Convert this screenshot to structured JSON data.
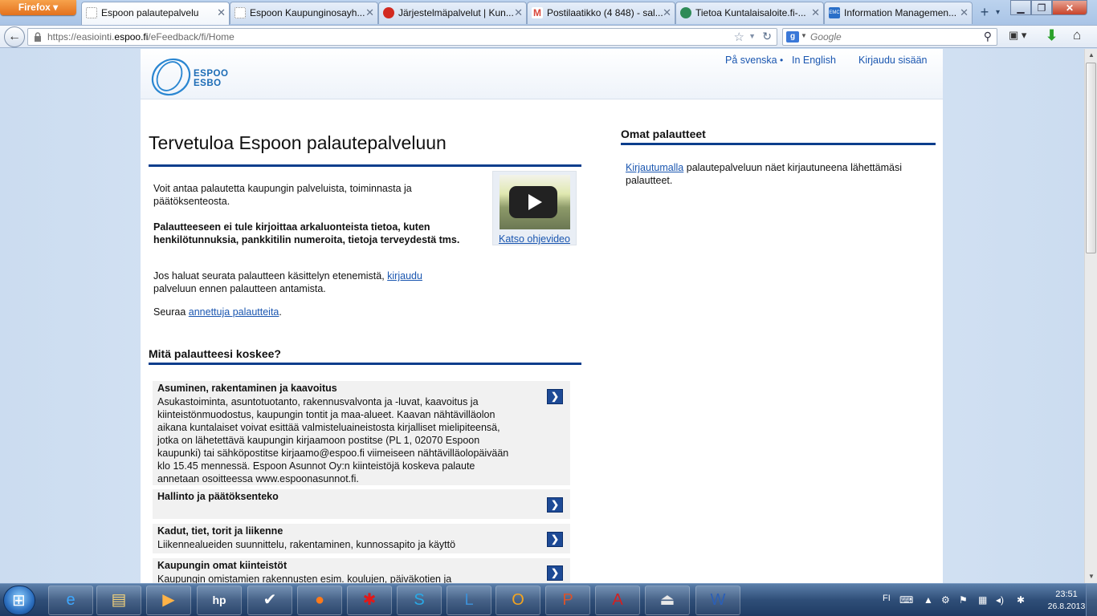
{
  "browser": {
    "menu_button": "Firefox",
    "tabs": [
      {
        "title": "Espoon palautepalvelu",
        "favicon_color": "#ffffff",
        "active": true
      },
      {
        "title": "Espoon Kaupunginosayh...",
        "favicon_color": "#ffffff",
        "active": false
      },
      {
        "title": "Järjestelmäpalvelut | Kun...",
        "favicon_color": "#d22a20",
        "active": false
      },
      {
        "title": "Postilaatikko (4 848) - sal...",
        "favicon_color": "#d9453a",
        "active": false
      },
      {
        "title": "Tietoa Kuntalaisaloite.fi-...",
        "favicon_color": "#2e8b57",
        "active": false
      },
      {
        "title": "Information Managemen...",
        "favicon_color": "#2a6fc8",
        "active": false
      }
    ],
    "url_prefix": "https://easiointi.",
    "url_domain": "espoo.fi",
    "url_path": "/eFeedback/fi/Home",
    "search_placeholder": "Google",
    "search_engine_icon_letter": "g"
  },
  "header": {
    "logo_line1": "ESPOO",
    "logo_line2": "ESBO",
    "link_swedish": "På svenska",
    "link_separator": "•",
    "link_english": "In English",
    "link_login": "Kirjaudu sisään"
  },
  "main": {
    "heading": "Tervetuloa Espoon palautepalveluun",
    "intro_text": "Voit antaa palautetta kaupungin palveluista, toiminnasta ja päätöksenteosta.",
    "warning_text": "Palautteeseen ei tule kirjoittaa arkaluonteista tietoa, kuten henkilötunnuksia, pankkitilin numeroita, tietoja terveydestä tms.",
    "follow_text_before": "Jos haluat seurata palautteen käsittelyn etenemistä, ",
    "follow_link": "kirjaudu",
    "follow_text_after": " palveluun ennen palautteen antamista.",
    "seuraa_before": "Seuraa ",
    "seuraa_link": "annettuja palautteita",
    "seuraa_after": ".",
    "video_link": "Katso ohjevideo",
    "topics_heading": "Mitä palautteesi koskee?",
    "categories": [
      {
        "title": "Asuminen, rakentaminen ja kaavoitus",
        "description": "Asukastoiminta, asuntotuotanto, rakennusvalvonta ja -luvat, kaavoitus ja kiinteistönmuodostus, kaupungin tontit ja maa-alueet. Kaavan nähtävilläolon aikana kuntalaiset voivat esittää valmisteluaineistosta kirjalliset mielipiteensä, jotka on lähetettävä kaupungin kirjaamoon postitse (PL 1, 02070 Espoon kaupunki) tai sähköpostitse kirjaamo@espoo.fi viimeiseen nähtävilläolopäivään klo 15.45 mennessä. Espoon Asunnot Oy:n kiinteistöjä koskeva palaute annetaan osoitteessa www.espoonasunnot.fi."
      },
      {
        "title": "Hallinto ja päätöksenteko",
        "description": ""
      },
      {
        "title": "Kadut, tiet, torit ja liikenne",
        "description": "Liikennealueiden suunnittelu, rakentaminen, kunnossapito ja käyttö"
      },
      {
        "title": "Kaupungin omat kiinteistöt",
        "description": "Kaupungin omistamien rakennusten esim. koulujen, päiväkotien ja"
      }
    ],
    "arrow_glyph": "❯"
  },
  "sidebar": {
    "heading": "Omat palautteet",
    "link": "Kirjautumalla",
    "text": " palautepalveluun näet kirjautuneena lähettämäsi palautteet."
  },
  "taskbar": {
    "items": [
      {
        "icon": "internet-explorer-icon",
        "glyph": "e",
        "color": "#3ea8ff"
      },
      {
        "icon": "file-explorer-icon",
        "glyph": "▤",
        "color": "#f3d27a"
      },
      {
        "icon": "media-player-icon",
        "glyph": "▶",
        "color": "#ffb347"
      },
      {
        "icon": "hp-icon",
        "glyph": "hp",
        "color": "#ffffff"
      },
      {
        "icon": "network-tool-icon",
        "glyph": "✔",
        "color": "#ffffff"
      },
      {
        "icon": "firefox-icon",
        "glyph": "●",
        "color": "#ff7a1a"
      },
      {
        "icon": "paint-splash-icon",
        "glyph": "✱",
        "color": "#e21818"
      },
      {
        "icon": "skype-icon",
        "glyph": "S",
        "color": "#29a9e6"
      },
      {
        "icon": "lync-icon",
        "glyph": "L",
        "color": "#3d8fd6"
      },
      {
        "icon": "outlook-icon",
        "glyph": "O",
        "color": "#f2a420"
      },
      {
        "icon": "powerpoint-icon",
        "glyph": "P",
        "color": "#d9532b"
      },
      {
        "icon": "acrobat-icon",
        "glyph": "A",
        "color": "#d41f1f"
      },
      {
        "icon": "eject-drive-icon",
        "glyph": "⏏",
        "color": "#e8e8e8"
      },
      {
        "icon": "word-icon",
        "glyph": "W",
        "color": "#2b5fb6"
      }
    ],
    "language": "FI",
    "time": "23:51",
    "date": "26.8.2013"
  }
}
